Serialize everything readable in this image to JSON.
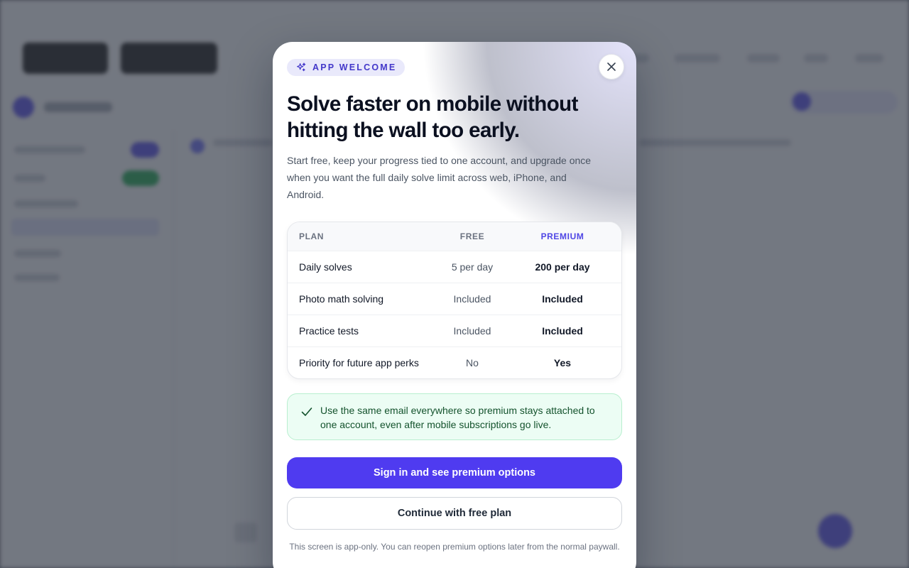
{
  "modal": {
    "badge": "APP WELCOME",
    "title": "Solve faster on mobile without hitting the wall too early.",
    "lead": "Start free, keep your progress tied to one account, and upgrade once when you want the full daily solve limit across web, iPhone, and Android.",
    "table": {
      "headers": [
        "PLAN",
        "FREE",
        "PREMIUM"
      ],
      "rows": [
        [
          "Daily solves",
          "5 per day",
          "200 per day"
        ],
        [
          "Photo math solving",
          "Included",
          "Included"
        ],
        [
          "Practice tests",
          "Included",
          "Included"
        ],
        [
          "Priority for future app perks",
          "No",
          "Yes"
        ]
      ]
    },
    "notice": "Use the same email everywhere so premium stays attached to one account, even after mobile subscriptions go live.",
    "primary_label": "Sign in and see premium options",
    "secondary_label": "Continue with free plan",
    "footnote": "This screen is app-only. You can reopen premium options later from the normal paywall."
  },
  "colors": {
    "accent": "#4f3bf0",
    "success_bg": "#ecfdf4",
    "success_border": "#b9efcf",
    "overlay": "#555a66"
  },
  "icons": {
    "badge": "sparkles-icon",
    "close": "close-icon",
    "notice": "check-icon"
  }
}
